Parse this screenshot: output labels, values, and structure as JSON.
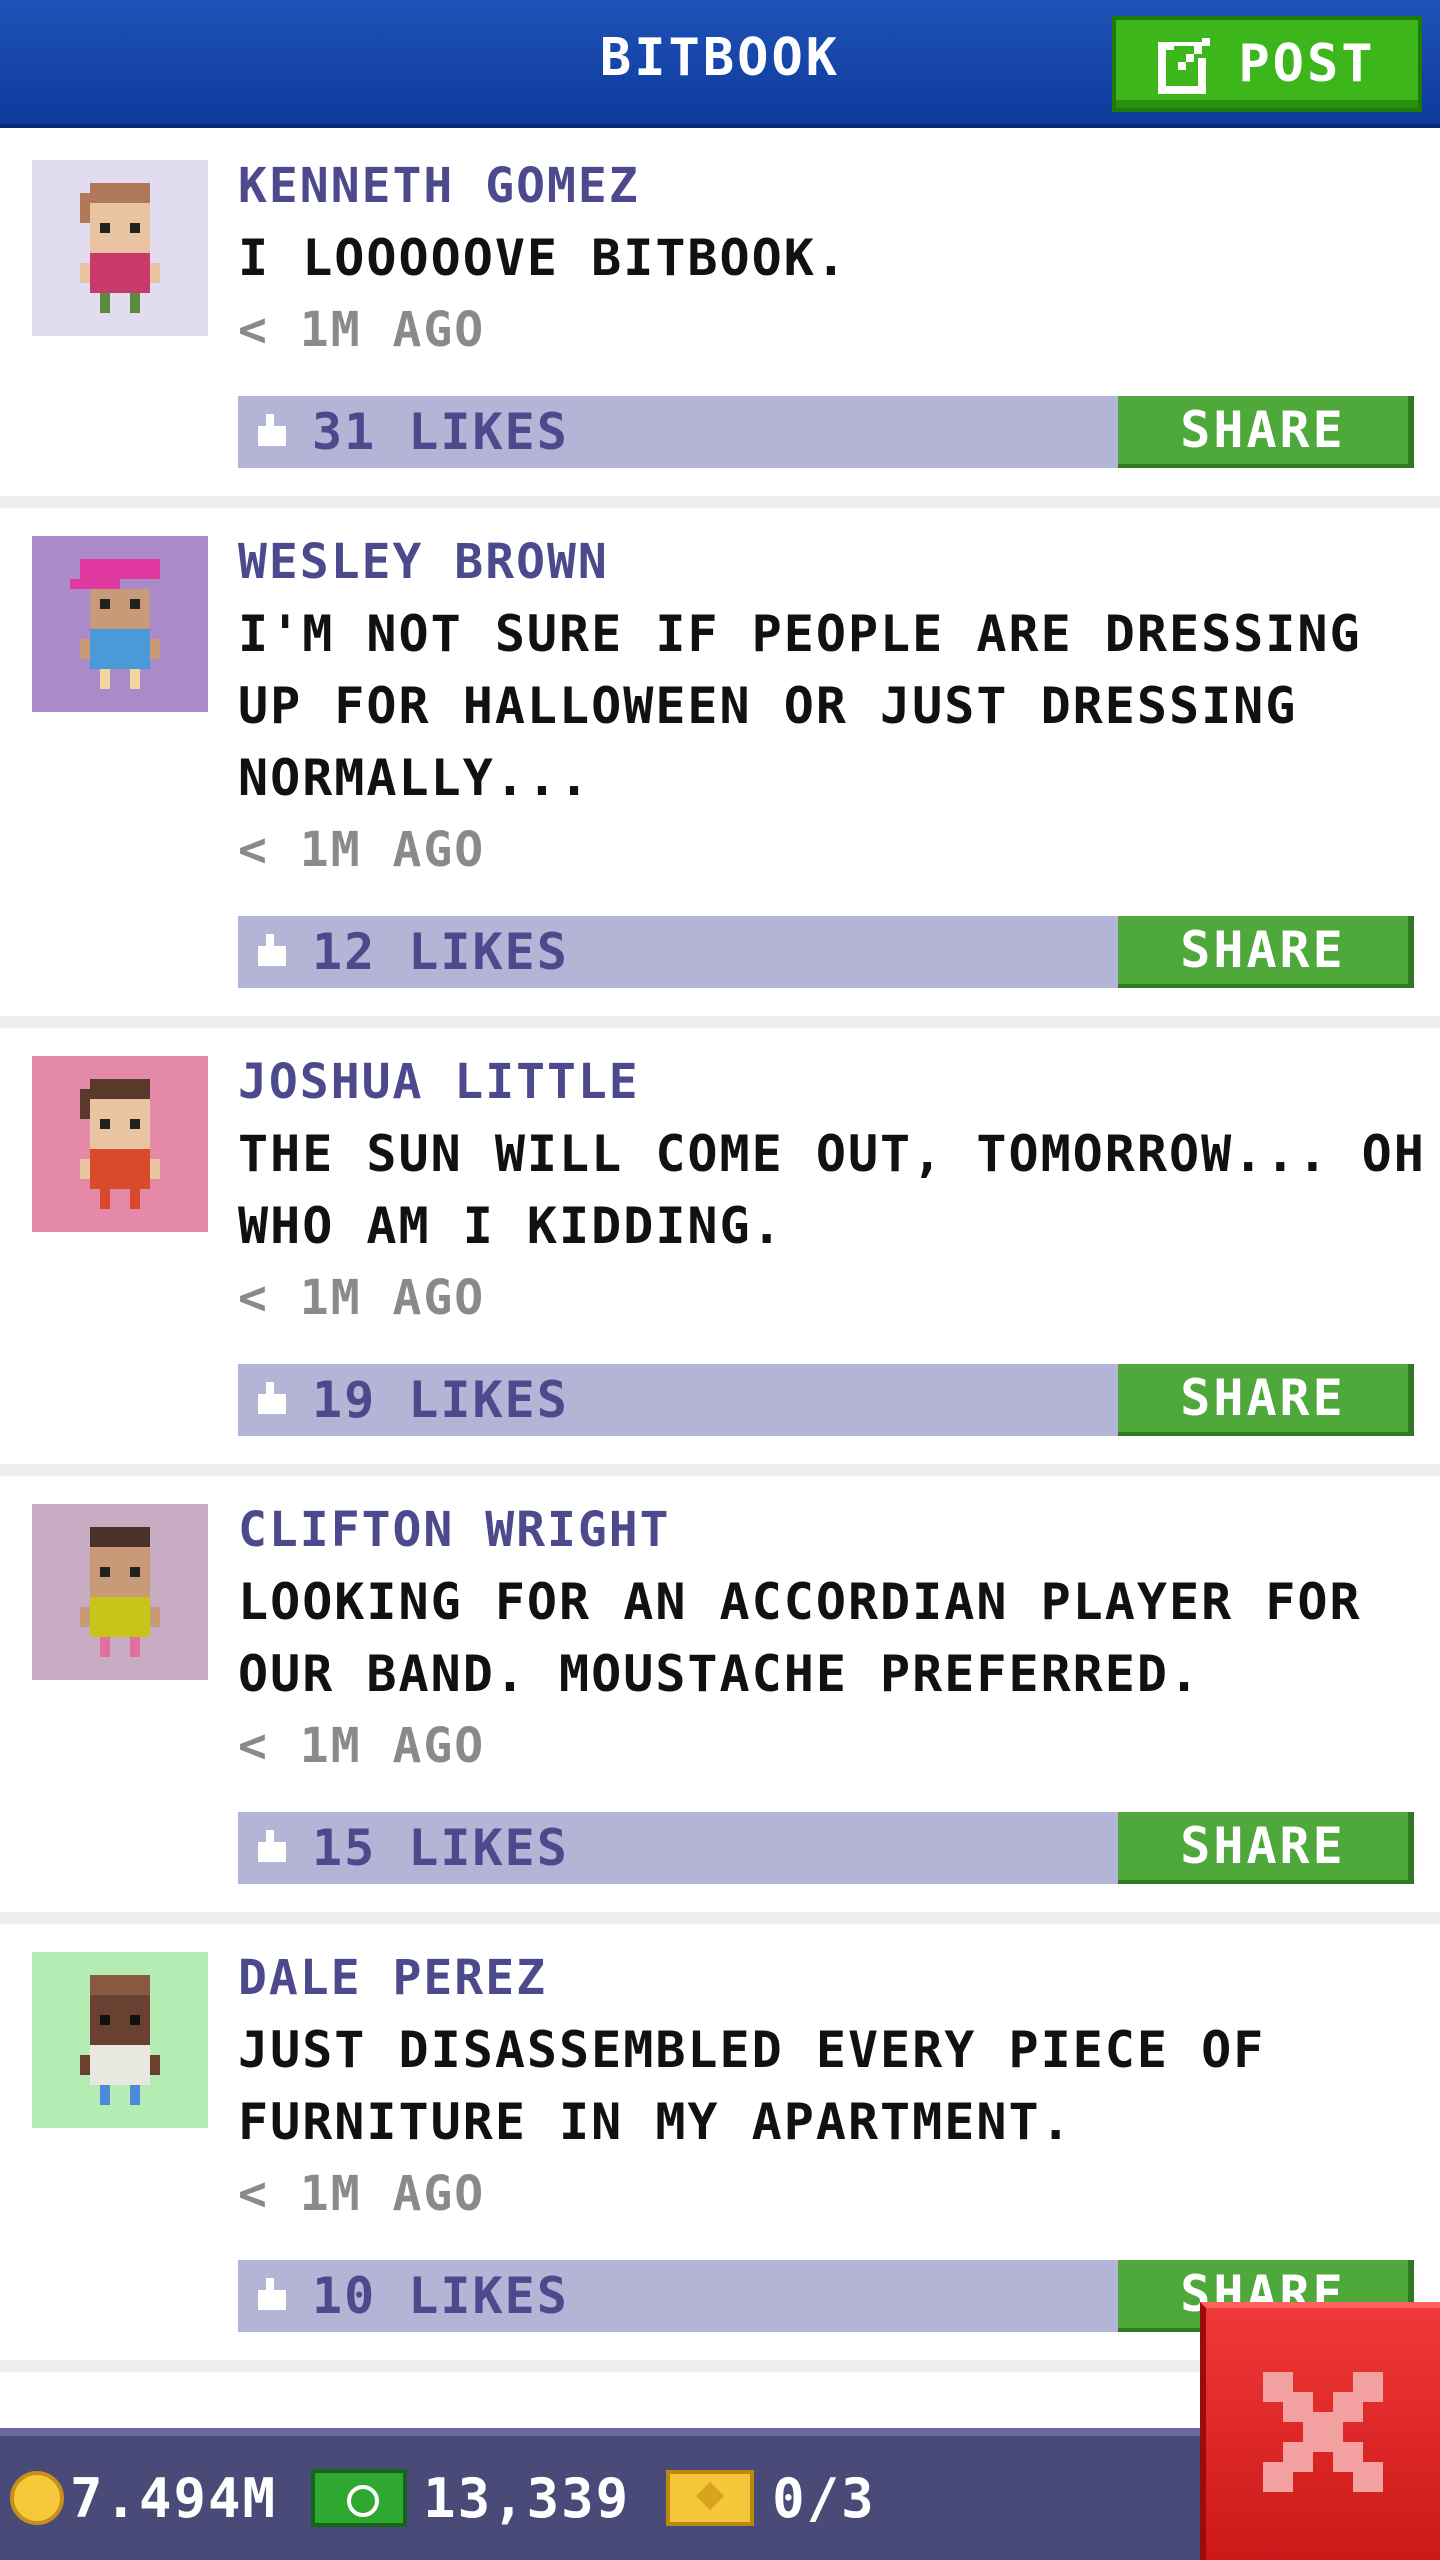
{
  "header": {
    "title": "BITBOOK",
    "post_label": "POST"
  },
  "posts": [
    {
      "author": "KENNETH GOMEZ",
      "text": "I LOOOOOVE BITBOOK.",
      "time": "< 1M AGO",
      "likes": "31 LIKES",
      "share_label": "SHARE",
      "avatar_bg": "#e2dcf0",
      "skin": "#eac4a0",
      "hair": "#b07a5a",
      "shirt": "#c83a6a"
    },
    {
      "author": "WESLEY BROWN",
      "text": "I'M NOT SURE IF PEOPLE ARE DRESSING UP FOR HALLOWEEN OR JUST DRESSING NORMALLY...",
      "time": "< 1M AGO",
      "likes": "12 LIKES",
      "share_label": "SHARE",
      "avatar_bg": "#aa8ac8",
      "skin": "#c89a78",
      "hair": "#e03aa0",
      "shirt": "#4a9ad8"
    },
    {
      "author": "JOSHUA LITTLE",
      "text": "THE SUN WILL COME OUT, TOMORROW... OH WHO AM I KIDDING.",
      "time": "< 1M AGO",
      "likes": "19 LIKES",
      "share_label": "SHARE",
      "avatar_bg": "#e48aa8",
      "skin": "#eac4a0",
      "hair": "#5a3a2a",
      "shirt": "#d84a2a"
    },
    {
      "author": "CLIFTON WRIGHT",
      "text": "LOOKING FOR AN ACCORDIAN PLAYER FOR OUR BAND. MOUSTACHE PREFERRED.",
      "time": "< 1M AGO",
      "likes": "15 LIKES",
      "share_label": "SHARE",
      "avatar_bg": "#c8acc4",
      "skin": "#c89a78",
      "hair": "#4a3028",
      "shirt": "#c8c41a"
    },
    {
      "author": "DALE PEREZ",
      "text": "JUST DISASSEMBLED EVERY PIECE OF FURNITURE IN MY APARTMENT.",
      "time": "< 1M AGO",
      "likes": "10 LIKES",
      "share_label": "SHARE",
      "avatar_bg": "#b4ecb4",
      "skin": "#6a4030",
      "hair": "#8a5a40",
      "shirt": "#e8e8e0"
    }
  ],
  "bottom_bar": {
    "coins": "7.494M",
    "bux": "13,339",
    "tickets": "0/3"
  },
  "colors": {
    "header_blue": "#1a48aa",
    "post_green": "#3cb61a",
    "author_purple": "#4c4a8c",
    "like_bar": "#b3b4d6",
    "share_green": "#4ea83a",
    "close_red": "#e02828"
  }
}
